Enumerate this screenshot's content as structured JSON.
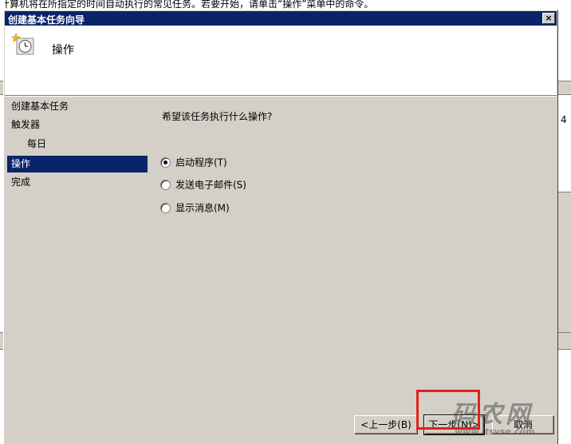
{
  "background": {
    "top_text": "计算机将在所指定的时间自动执行的常见任务。若要开始，请单击“操作”菜单中的命令。",
    "right_number": "4"
  },
  "dialog": {
    "title": "创建基本任务向导",
    "close_glyph": "×",
    "header_title": "操作",
    "header_icon": "clock-task-icon"
  },
  "nav": {
    "items": [
      {
        "label": "创建基本任务"
      },
      {
        "label": "触发器"
      },
      {
        "label": "每日"
      },
      {
        "label": "操作"
      },
      {
        "label": "完成"
      }
    ],
    "selected": "操作"
  },
  "main": {
    "question": "希望该任务执行什么操作?",
    "options": [
      {
        "label": "启动程序(T)",
        "checked": true
      },
      {
        "label": "发送电子邮件(S)",
        "checked": false
      },
      {
        "label": "显示消息(M)",
        "checked": false
      }
    ]
  },
  "buttons": {
    "back": "<上一步(B)",
    "next": "下一步(N)>",
    "cancel": "取消"
  },
  "watermark": {
    "big": "码农网",
    "small": "www.ltsvse.com"
  },
  "colors": {
    "titlebar": "#0a246a",
    "dialog_bg": "#d4d0c8",
    "selection": "#0a246a",
    "highlight_box": "#e0221c"
  }
}
